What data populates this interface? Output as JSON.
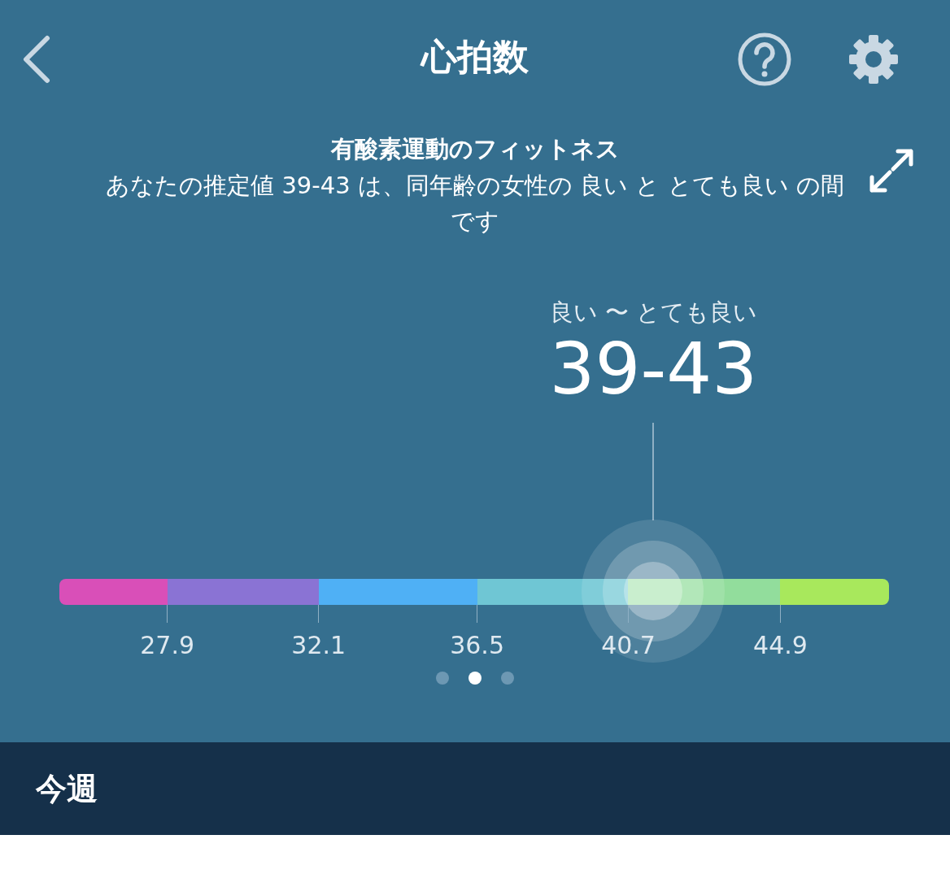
{
  "header": {
    "title": "心拍数"
  },
  "fitness": {
    "heading": "有酸素運動のフィットネス",
    "description": "あなたの推定値 39-43 は、同年齢の女性の 良い と とても良い の間です"
  },
  "readout": {
    "category": "良い 〜 とても良い",
    "value": "39-43"
  },
  "scale": {
    "segments": [
      {
        "color": "#d94fb8"
      },
      {
        "color": "#8a73d4"
      },
      {
        "color": "#4fb0f5"
      },
      {
        "color": "#6fc6d4"
      },
      {
        "color": "#92dd9c"
      },
      {
        "color": "#a8e85c"
      }
    ],
    "ticks": [
      "27.9",
      "32.1",
      "36.5",
      "40.7",
      "44.9"
    ]
  },
  "pager": [
    {
      "selected": false
    },
    {
      "selected": true
    },
    {
      "selected": false
    }
  ],
  "section": {
    "title": "今週"
  }
}
